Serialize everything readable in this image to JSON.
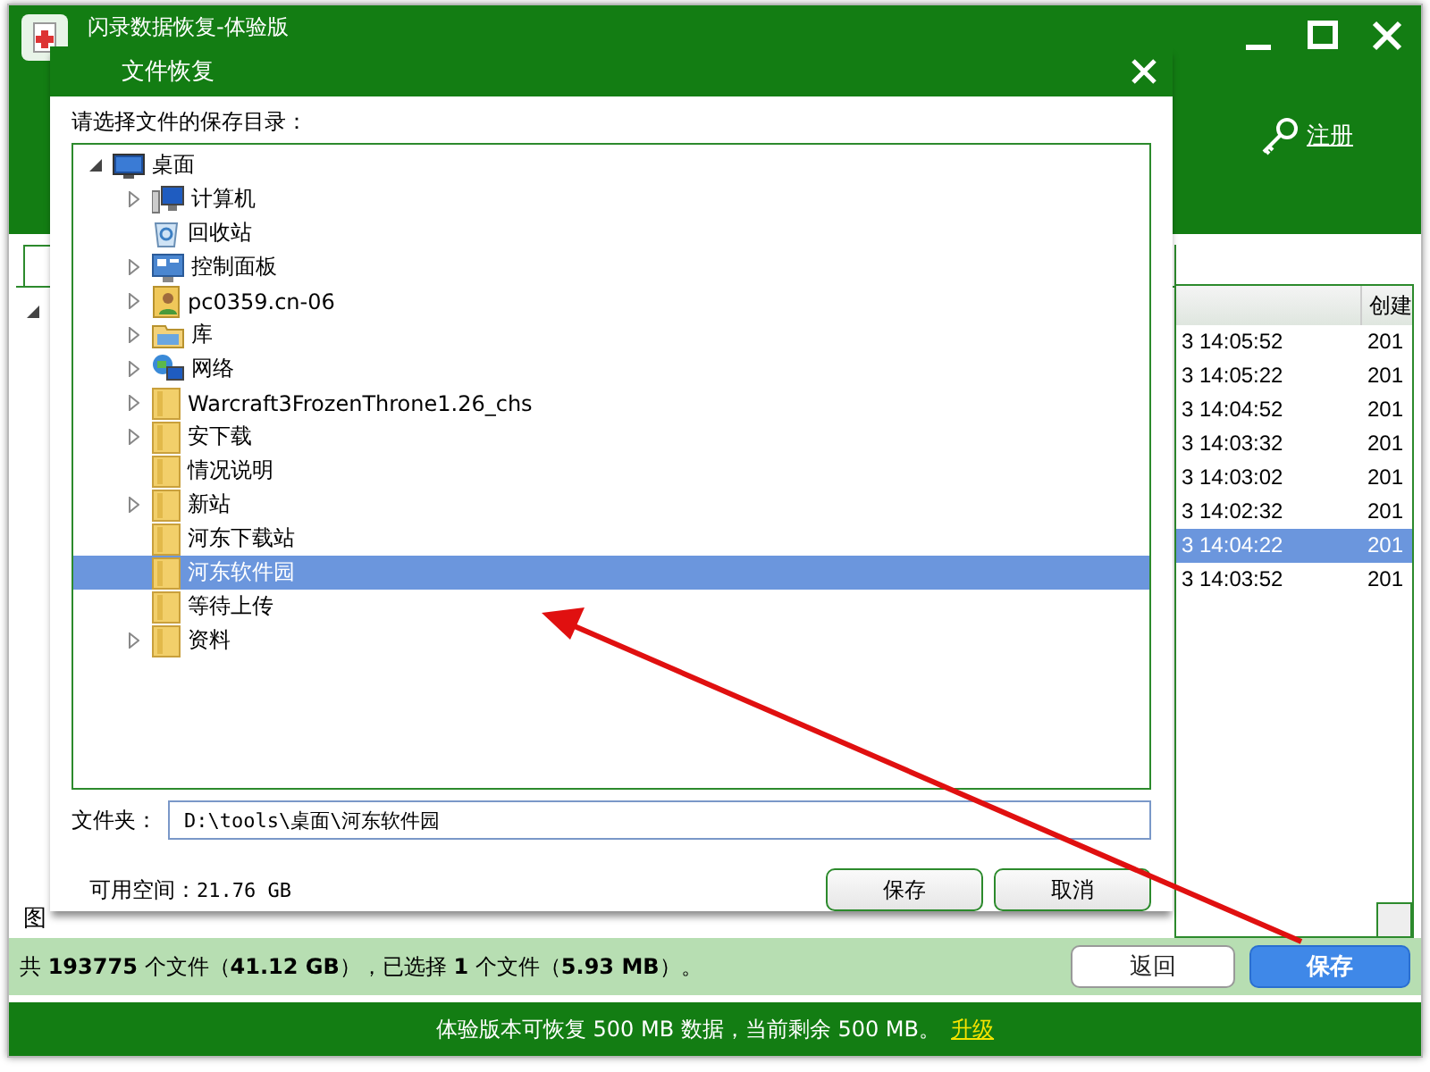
{
  "main_window": {
    "title": "闪录数据恢复-体验版",
    "register_link": "注册",
    "left_panel": {
      "bottom_label": "图"
    },
    "table": {
      "column_2_header": "创建",
      "rows": [
        {
          "column_1": "3 14:05:52",
          "column_2": "201",
          "selected": false
        },
        {
          "column_1": "3 14:05:22",
          "column_2": "201",
          "selected": false
        },
        {
          "column_1": "3 14:04:52",
          "column_2": "201",
          "selected": false
        },
        {
          "column_1": "3 14:03:32",
          "column_2": "201",
          "selected": false
        },
        {
          "column_1": "3 14:03:02",
          "column_2": "201",
          "selected": false
        },
        {
          "column_1": "3 14:02:32",
          "column_2": "201",
          "selected": false
        },
        {
          "column_1": "3 14:04:22",
          "column_2": "201",
          "selected": true
        },
        {
          "column_1": "3 14:03:52",
          "column_2": "201",
          "selected": false
        }
      ]
    },
    "status_text": "共 **193775** 个文件（**41.12 GB**），已选择 **1** 个文件（**5.93 MB**）。",
    "buttons": [
      {
        "label": "返回",
        "kind": "secondary"
      },
      {
        "label": "保存",
        "kind": "primary"
      }
    ],
    "footer": {
      "text": "体验版本可恢复 500 MB 数据，当前剩余 500 MB。",
      "link": "升级"
    }
  },
  "dialog": {
    "title": "文件恢复",
    "prompt": "请选择文件的保存目录：",
    "tree": [
      {
        "label": "桌面",
        "kind": "desktop",
        "expanded": true,
        "selected": false,
        "children": [
          {
            "label": "计算机",
            "kind": "computer",
            "expandable": true,
            "selected": false
          },
          {
            "label": "回收站",
            "kind": "recycle",
            "expandable": false,
            "selected": false
          },
          {
            "label": "控制面板",
            "kind": "control",
            "expandable": true,
            "selected": false
          },
          {
            "label": "pc0359.cn-06",
            "kind": "user",
            "expandable": true,
            "selected": false
          },
          {
            "label": "库",
            "kind": "library",
            "expandable": true,
            "selected": false
          },
          {
            "label": "网络",
            "kind": "network",
            "expandable": true,
            "selected": false
          },
          {
            "label": "Warcraft3FrozenThrone1.26_chs",
            "kind": "folder",
            "expandable": true,
            "selected": false
          },
          {
            "label": "安下载",
            "kind": "folder",
            "expandable": true,
            "selected": false
          },
          {
            "label": "情况说明",
            "kind": "folder",
            "expandable": false,
            "selected": false
          },
          {
            "label": "新站",
            "kind": "folder",
            "expandable": true,
            "selected": false
          },
          {
            "label": "河东下载站",
            "kind": "folder",
            "expandable": false,
            "selected": false
          },
          {
            "label": "河东软件园",
            "kind": "folder",
            "expandable": false,
            "selected": true
          },
          {
            "label": "等待上传",
            "kind": "folder",
            "expandable": false,
            "selected": false
          },
          {
            "label": "资料",
            "kind": "folder",
            "expandable": true,
            "selected": false
          }
        ]
      }
    ],
    "folder_label": "文件夹：",
    "folder_value": "D:\\tools\\桌面\\河东软件园",
    "free_space_label": "可用空间：",
    "free_space_value": "21.76 GB",
    "buttons": [
      {
        "label": "保存"
      },
      {
        "label": "取消"
      }
    ]
  }
}
